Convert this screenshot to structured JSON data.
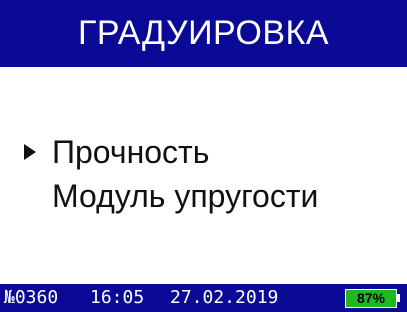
{
  "header": {
    "title": "ГРАДУИРОВКА"
  },
  "menu": {
    "items": [
      {
        "label": "Прочность",
        "selected": true
      },
      {
        "label": "Модуль упругости",
        "selected": false
      }
    ]
  },
  "status_bar": {
    "serial": "№0360",
    "time": "16:05",
    "date": "27.02.2019",
    "battery": "87%"
  },
  "colors": {
    "header_bg": "#0a0a96",
    "battery_fill": "#20b820"
  }
}
